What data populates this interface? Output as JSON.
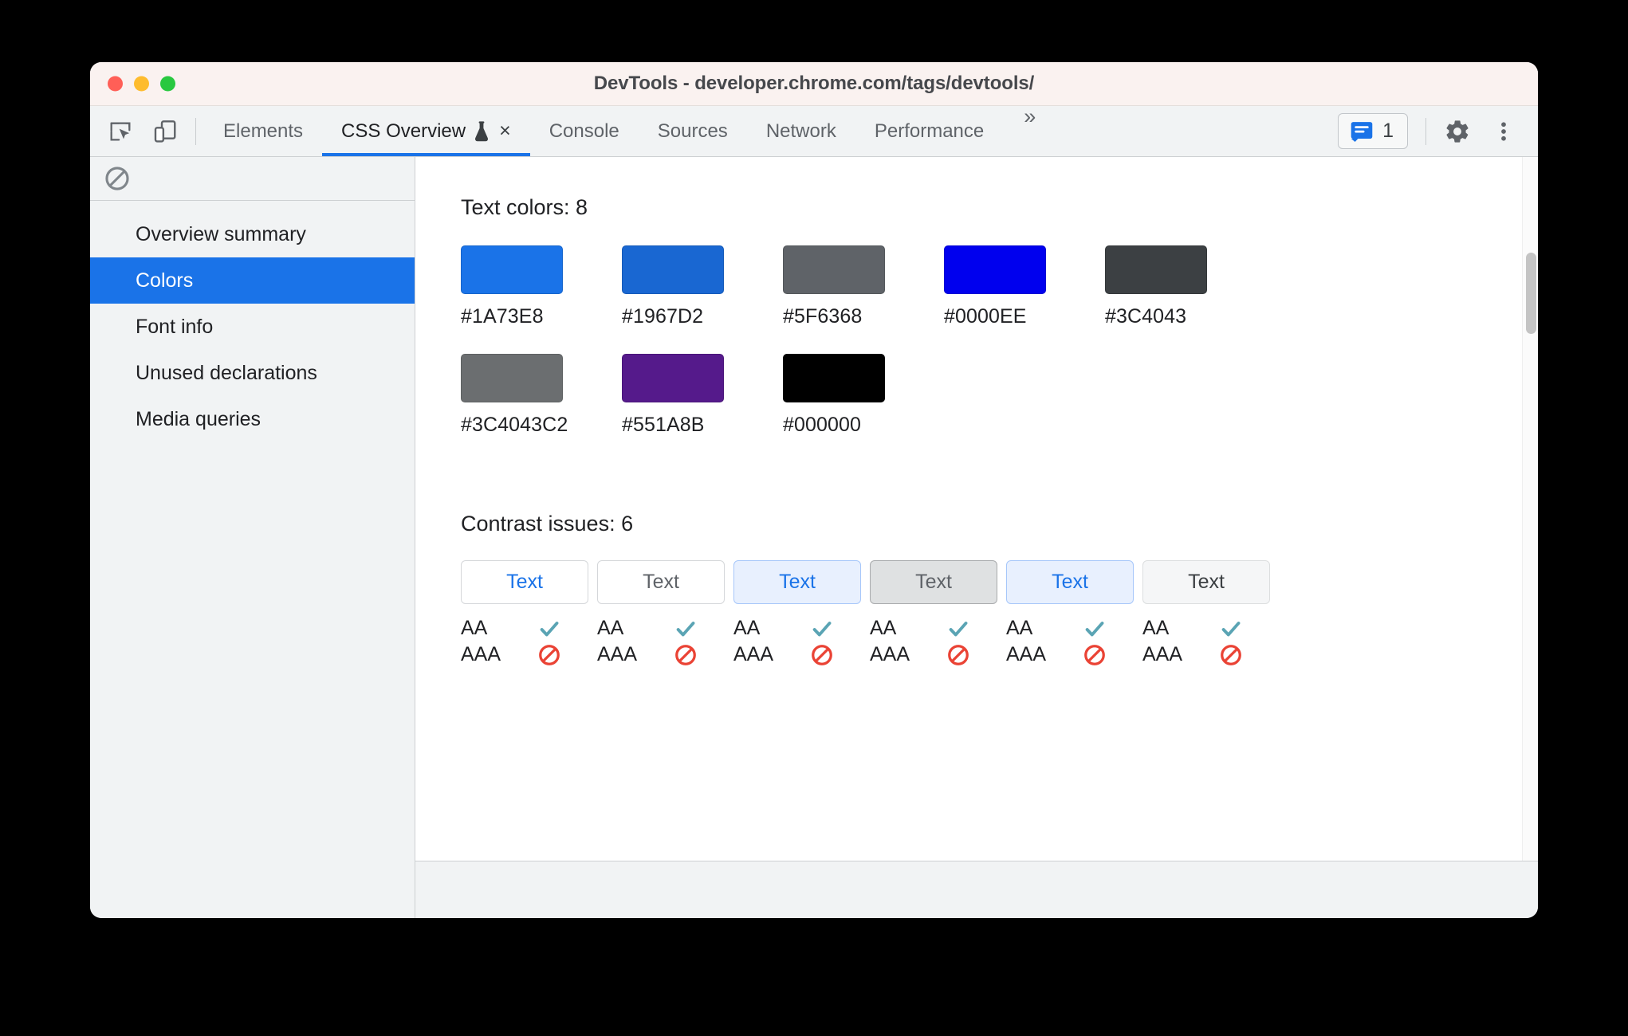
{
  "window": {
    "title": "DevTools - developer.chrome.com/tags/devtools/",
    "traffic_lights": {
      "close": "close-window",
      "minimize": "minimize-window",
      "maximize": "maximize-window"
    }
  },
  "toolbar": {
    "inspect_icon": "inspect-element-icon",
    "device_icon": "device-toolbar-icon",
    "tabs": [
      {
        "label": "Elements",
        "active": false,
        "closable": false,
        "experimental": false
      },
      {
        "label": "CSS Overview",
        "active": true,
        "closable": true,
        "experimental": true,
        "flask_icon": "flask-icon",
        "close_icon": "close-icon",
        "close_label": "×"
      },
      {
        "label": "Console",
        "active": false,
        "closable": false,
        "experimental": false
      },
      {
        "label": "Sources",
        "active": false,
        "closable": false,
        "experimental": false
      },
      {
        "label": "Network",
        "active": false,
        "closable": false,
        "experimental": false
      },
      {
        "label": "Performance",
        "active": false,
        "closable": false,
        "experimental": false
      }
    ],
    "more_tabs_label": "»",
    "more_tabs_icon": "chevron-double-right-icon",
    "issues": {
      "icon": "issues-message-icon",
      "count": "1",
      "accent": "#1a73e8"
    },
    "settings_icon": "gear-icon",
    "more_options_icon": "kebab-menu-icon"
  },
  "sidebar": {
    "clear_icon": "clear-overview-icon",
    "items": [
      {
        "label": "Overview summary",
        "selected": false
      },
      {
        "label": "Colors",
        "selected": true
      },
      {
        "label": "Font info",
        "selected": false
      },
      {
        "label": "Unused declarations",
        "selected": false
      },
      {
        "label": "Media queries",
        "selected": false
      }
    ],
    "selected_bg": "#1a73e8"
  },
  "main": {
    "text_colors": {
      "title": "Text colors: 8",
      "count": 8,
      "swatches": [
        {
          "label": "#1A73E8",
          "color": "#1A73E8"
        },
        {
          "label": "#1967D2",
          "color": "#1967D2"
        },
        {
          "label": "#5F6368",
          "color": "#5F6368"
        },
        {
          "label": "#0000EE",
          "color": "#0000EE"
        },
        {
          "label": "#3C4043",
          "color": "#3C4043"
        },
        {
          "label": "#3C4043C2",
          "color": "#3C4043C2"
        },
        {
          "label": "#551A8B",
          "color": "#551A8B"
        },
        {
          "label": "#000000",
          "color": "#000000"
        }
      ]
    },
    "contrast_issues": {
      "title": "Contrast issues: 6",
      "count": 6,
      "level_aa": "AA",
      "level_aaa": "AAA",
      "pass_icon": "checkmark-icon",
      "fail_icon": "no-entry-icon",
      "pass_color": "#5aa4b4",
      "fail_color": "#ea4335",
      "items": [
        {
          "sample_text": "Text",
          "text_color": "#1A73E8",
          "bg_color": "#ffffff",
          "border_color": "#d5d7da",
          "aa_pass": true,
          "aaa_pass": false
        },
        {
          "sample_text": "Text",
          "text_color": "#5F6368",
          "bg_color": "#ffffff",
          "border_color": "#d5d7da",
          "aa_pass": true,
          "aaa_pass": false
        },
        {
          "sample_text": "Text",
          "text_color": "#1A73E8",
          "bg_color": "#e8f0fe",
          "border_color": "#a7c7fa",
          "aa_pass": true,
          "aaa_pass": false
        },
        {
          "sample_text": "Text",
          "text_color": "#5F6368",
          "bg_color": "#dfe1e2",
          "border_color": "#a9abad",
          "aa_pass": true,
          "aaa_pass": false
        },
        {
          "sample_text": "Text",
          "text_color": "#1A73E8",
          "bg_color": "#e8f0fe",
          "border_color": "#a7c7fa",
          "aa_pass": true,
          "aaa_pass": false
        },
        {
          "sample_text": "Text",
          "text_color": "#3C4043",
          "bg_color": "#f5f6f7",
          "border_color": "#dcdedf",
          "aa_pass": true,
          "aaa_pass": false
        }
      ]
    },
    "scrollbar": {
      "name": "vertical-scrollbar"
    }
  }
}
